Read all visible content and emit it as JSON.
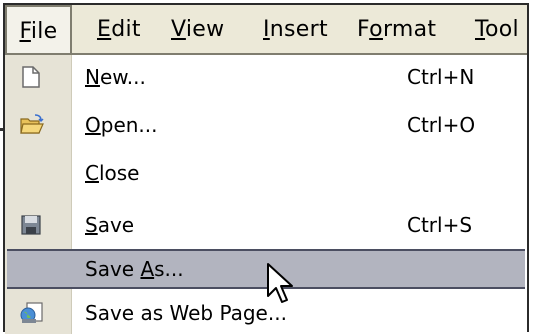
{
  "menubar": {
    "items": [
      {
        "label": "File",
        "mnemonic_index": 0
      },
      {
        "label": "Edit",
        "mnemonic_index": 0
      },
      {
        "label": "View",
        "mnemonic_index": 0
      },
      {
        "label": "Insert",
        "mnemonic_index": 0
      },
      {
        "label": "Format",
        "mnemonic_index": 1
      },
      {
        "label": "Tool",
        "mnemonic_index": 0
      }
    ]
  },
  "file_menu": {
    "items": [
      {
        "label": "New...",
        "shortcut": "Ctrl+N",
        "icon": "new-document-icon"
      },
      {
        "label": "Open...",
        "shortcut": "Ctrl+O",
        "icon": "open-folder-icon"
      },
      {
        "label": "Close",
        "shortcut": "",
        "icon": ""
      },
      {
        "label": "Save",
        "shortcut": "Ctrl+S",
        "icon": "floppy-disk-icon"
      },
      {
        "label": "Save As...",
        "shortcut": "",
        "icon": "",
        "highlighted": true
      },
      {
        "label": "Save as Web Page...",
        "shortcut": "",
        "icon": "web-page-icon"
      }
    ]
  },
  "colors": {
    "menubar_bg": "#ece9d8",
    "gutter_bg": "#e6e3d6",
    "highlight_bg": "#b2b4bf",
    "highlight_border": "#4b4e61"
  }
}
